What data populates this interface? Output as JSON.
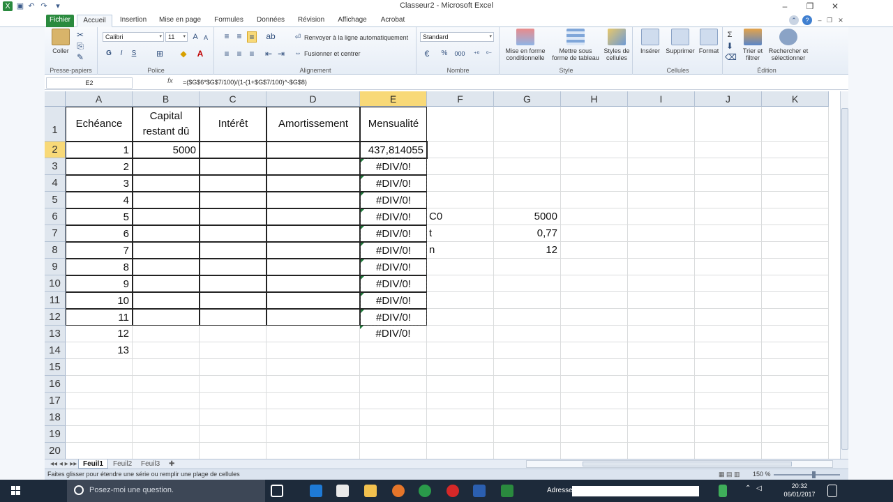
{
  "window": {
    "title": "Classeur2 - Microsoft Excel"
  },
  "tabs": [
    "Fichier",
    "Accueil",
    "Insertion",
    "Mise en page",
    "Formules",
    "Données",
    "Révision",
    "Affichage",
    "Acrobat"
  ],
  "ribbon": {
    "clipboard": {
      "paste_label": "Coller",
      "group_label": "Presse-papiers"
    },
    "font": {
      "font_name": "Calibri",
      "font_size": "11",
      "bold": "G",
      "italic": "I",
      "underline": "S",
      "group_label": "Police"
    },
    "alignment": {
      "wrap_label": "Renvoyer à la ligne automatiquement",
      "merge_label": "Fusionner et centrer",
      "group_label": "Alignement"
    },
    "number": {
      "format": "Standard",
      "percent": "%",
      "thousands": "000",
      "group_label": "Nombre"
    },
    "style": {
      "conditional": "Mise en forme conditionnelle",
      "table": "Mettre sous forme de tableau",
      "cell_styles": "Styles de cellules",
      "group_label": "Style"
    },
    "cells": {
      "insert": "Insérer",
      "delete": "Supprimer",
      "format": "Format",
      "group_label": "Cellules"
    },
    "editing": {
      "sort": "Trier et filtrer",
      "find": "Rechercher et sélectionner",
      "sigma": "Σ",
      "group_label": "Édition"
    }
  },
  "formula_bar": {
    "name_box": "E2",
    "fx": "fx",
    "formula": "=($G$6*$G$7/100)/(1-(1+$G$7/100)^-$G$8)"
  },
  "grid": {
    "columns": [
      "A",
      "B",
      "C",
      "D",
      "E",
      "F",
      "G",
      "H",
      "I",
      "J",
      "K"
    ],
    "rows": [
      "1",
      "2",
      "3",
      "4",
      "5",
      "6",
      "7",
      "8",
      "9",
      "10",
      "11",
      "12",
      "13",
      "14",
      "15",
      "16",
      "17",
      "18",
      "19",
      "20"
    ],
    "headers": [
      "Echéance",
      "Capital restant dû",
      "Intérêt",
      "Amortissement",
      "Mensualité"
    ],
    "echeance": [
      "1",
      "2",
      "3",
      "4",
      "5",
      "6",
      "7",
      "8",
      "9",
      "10",
      "11",
      "12",
      "13"
    ],
    "capital_b2": "5000",
    "mensualite_e2": "437,814055",
    "errors": [
      "#DIV/0!",
      "#DIV/0!",
      "#DIV/0!",
      "#DIV/0!",
      "#DIV/0!",
      "#DIV/0!",
      "#DIV/0!",
      "#DIV/0!",
      "#DIV/0!",
      "#DIV/0!",
      "#DIV/0!"
    ],
    "params": [
      {
        "label": "C0",
        "value": "5000"
      },
      {
        "label": "t",
        "value": "0,77"
      },
      {
        "label": "n",
        "value": "12"
      }
    ]
  },
  "sheets": [
    "Feuil1",
    "Feuil2",
    "Feuil3"
  ],
  "status": {
    "message": "Faites glisser pour étendre une série ou remplir une plage de cellules",
    "zoom": "150 %"
  },
  "taskbar": {
    "search_placeholder": "Posez-moi une question.",
    "address_label": "Adresse",
    "time": "20:32",
    "date": "06/01/2017"
  },
  "colors": {
    "file_tab": "#2a8a3e",
    "selected_header": "#f8d978",
    "error_marker": "#1f7a3a",
    "taskbar": "#1d2a3a"
  }
}
